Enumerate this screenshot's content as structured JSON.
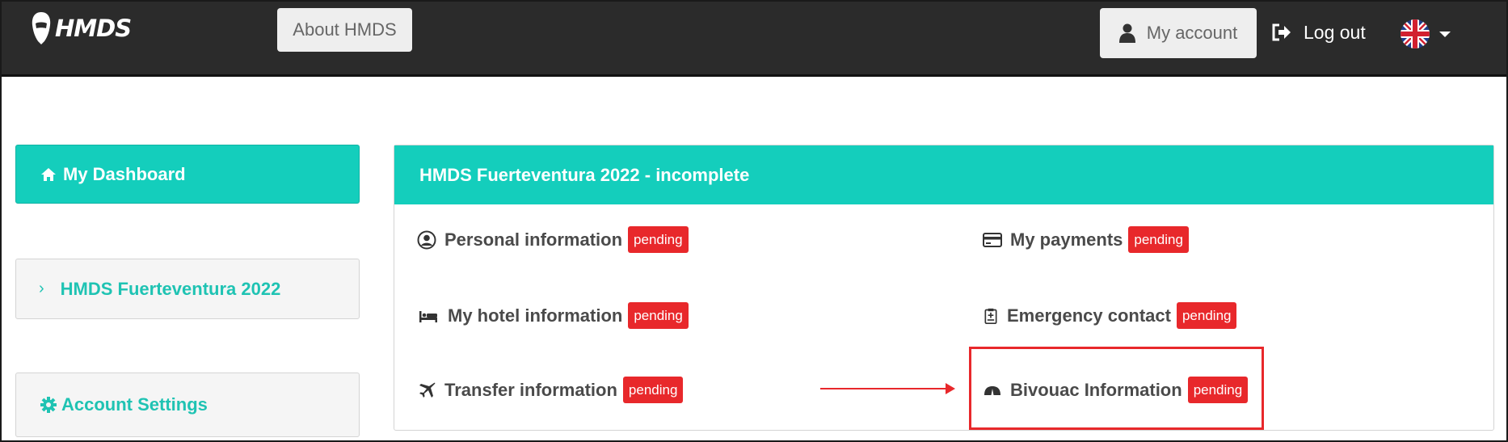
{
  "header": {
    "logo_text": "HMDS",
    "about_label": "About HMDS",
    "account_label": "My account",
    "logout_label": "Log out",
    "language_icon": "uk-flag-icon"
  },
  "sidebar": {
    "dashboard_label": "My Dashboard",
    "event_label": "HMDS Fuerteventura 2022",
    "settings_label": "Account Settings"
  },
  "panel": {
    "title": "HMDS Fuerteventura 2022 - incomplete",
    "items": [
      {
        "label": "Personal information",
        "status": "pending",
        "icon": "user-circle-icon"
      },
      {
        "label": "My payments",
        "status": "pending",
        "icon": "credit-card-icon"
      },
      {
        "label": "My hotel information",
        "status": "pending",
        "icon": "bed-icon"
      },
      {
        "label": "Emergency contact",
        "status": "pending",
        "icon": "clipboard-icon"
      },
      {
        "label": "Transfer information",
        "status": "pending",
        "icon": "plane-icon"
      },
      {
        "label": "Bivouac Information",
        "status": "pending",
        "icon": "tent-icon"
      }
    ]
  },
  "colors": {
    "accent": "#14cebc",
    "nav_bg": "#2b2b2b",
    "badge": "#e8282b"
  }
}
